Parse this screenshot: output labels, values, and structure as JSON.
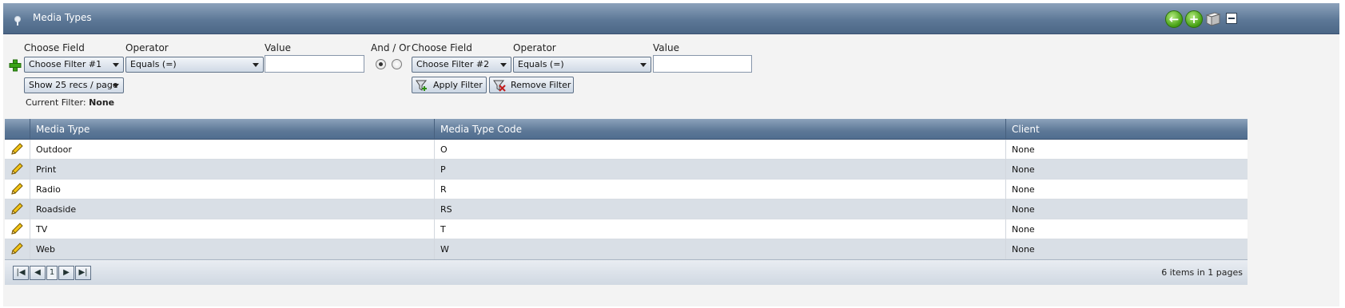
{
  "header": {
    "title": "Media Types",
    "icons": [
      "pin-icon",
      "back-arrow-icon",
      "add-icon",
      "export-icon",
      "minimize-icon"
    ]
  },
  "filter": {
    "choose_field_label": "Choose Field",
    "operator_label": "Operator",
    "value_label": "Value",
    "and_or_label": "And / Or",
    "filter1": {
      "field": "Choose Filter #1",
      "operator": "Equals (=)",
      "value": ""
    },
    "filter2": {
      "field": "Choose Filter #2",
      "operator": "Equals (=)",
      "value": ""
    },
    "page_size": "Show 25 recs / page",
    "apply_label": "Apply Filter",
    "remove_label": "Remove Filter",
    "current_filter_label": "Current Filter:",
    "current_filter_value": "None"
  },
  "table": {
    "columns": [
      "Media Type",
      "Media Type Code",
      "Client"
    ],
    "rows": [
      [
        "Outdoor",
        "O",
        "None"
      ],
      [
        "Print",
        "P",
        "None"
      ],
      [
        "Radio",
        "R",
        "None"
      ],
      [
        "Roadside",
        "RS",
        "None"
      ],
      [
        "TV",
        "T",
        "None"
      ],
      [
        "Web",
        "W",
        "None"
      ]
    ]
  },
  "pager": {
    "current_page": "1",
    "summary": "6 items in 1 pages"
  },
  "colors": {
    "header_blue": "#5d7897",
    "row_alt": "#d9dfe6",
    "accent_green": "#49a317"
  }
}
